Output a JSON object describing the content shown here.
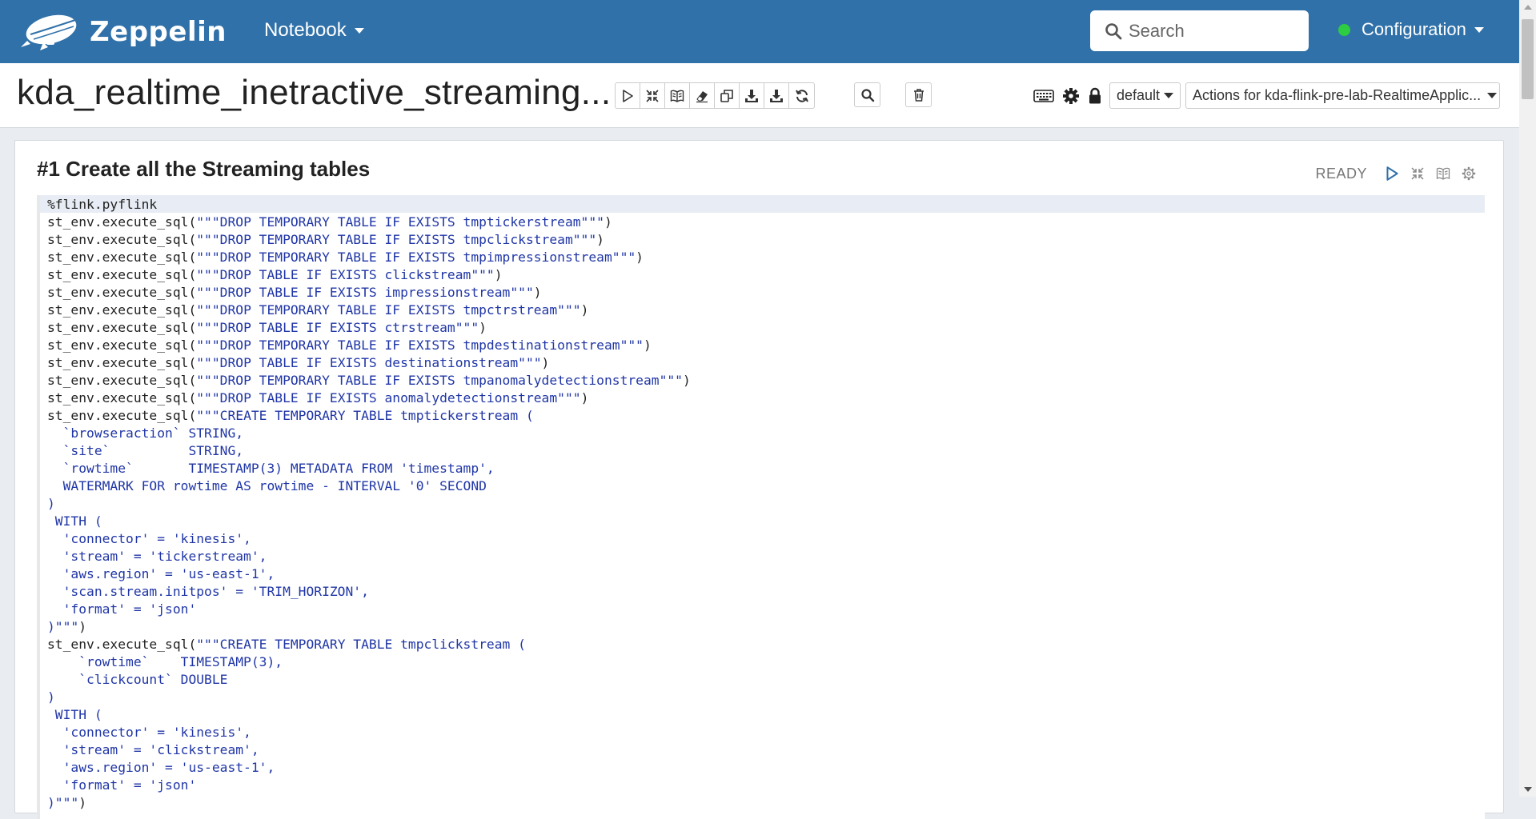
{
  "navbar": {
    "brand": "Zeppelin",
    "notebook_menu": "Notebook",
    "search_placeholder": "Search",
    "configuration": "Configuration"
  },
  "colors": {
    "navbar": "#3071a9",
    "status_connected": "#2ecc40",
    "code_string": "#2036a6"
  },
  "notebook": {
    "title": "kda_realtime_inetractive_streaming...",
    "toolbar_icons": [
      "run-all-icon",
      "hide-code-icon",
      "hide-output-icon",
      "clear-output-icon",
      "clone-icon",
      "export-icon",
      "export-ipynb-icon",
      "reload-icon",
      "search-code-icon",
      "trash-icon"
    ],
    "interpreter_select": "default",
    "actions_select": "Actions for kda-flink-pre-lab-RealtimeApplic..."
  },
  "paragraph": {
    "title": "#1 Create all the Streaming tables",
    "status": "READY",
    "code_lines": [
      [
        {
          "t": "%flink.pyflink",
          "s": false
        }
      ],
      [
        {
          "t": "st_env.execute_sql(",
          "s": false
        },
        {
          "t": "\"\"\"DROP TEMPORARY TABLE IF EXISTS tmptickerstream\"\"\"",
          "s": true
        },
        {
          "t": ")",
          "s": false
        }
      ],
      [
        {
          "t": "st_env.execute_sql(",
          "s": false
        },
        {
          "t": "\"\"\"DROP TEMPORARY TABLE IF EXISTS tmpclickstream\"\"\"",
          "s": true
        },
        {
          "t": ")",
          "s": false
        }
      ],
      [
        {
          "t": "st_env.execute_sql(",
          "s": false
        },
        {
          "t": "\"\"\"DROP TEMPORARY TABLE IF EXISTS tmpimpressionstream\"\"\"",
          "s": true
        },
        {
          "t": ")",
          "s": false
        }
      ],
      [
        {
          "t": "st_env.execute_sql(",
          "s": false
        },
        {
          "t": "\"\"\"DROP TABLE IF EXISTS clickstream\"\"\"",
          "s": true
        },
        {
          "t": ")",
          "s": false
        }
      ],
      [
        {
          "t": "st_env.execute_sql(",
          "s": false
        },
        {
          "t": "\"\"\"DROP TABLE IF EXISTS impressionstream\"\"\"",
          "s": true
        },
        {
          "t": ")",
          "s": false
        }
      ],
      [
        {
          "t": "st_env.execute_sql(",
          "s": false
        },
        {
          "t": "\"\"\"DROP TEMPORARY TABLE IF EXISTS tmpctrstream\"\"\"",
          "s": true
        },
        {
          "t": ")",
          "s": false
        }
      ],
      [
        {
          "t": "st_env.execute_sql(",
          "s": false
        },
        {
          "t": "\"\"\"DROP TABLE IF EXISTS ctrstream\"\"\"",
          "s": true
        },
        {
          "t": ")",
          "s": false
        }
      ],
      [
        {
          "t": "st_env.execute_sql(",
          "s": false
        },
        {
          "t": "\"\"\"DROP TEMPORARY TABLE IF EXISTS tmpdestinationstream\"\"\"",
          "s": true
        },
        {
          "t": ")",
          "s": false
        }
      ],
      [
        {
          "t": "st_env.execute_sql(",
          "s": false
        },
        {
          "t": "\"\"\"DROP TABLE IF EXISTS destinationstream\"\"\"",
          "s": true
        },
        {
          "t": ")",
          "s": false
        }
      ],
      [
        {
          "t": "st_env.execute_sql(",
          "s": false
        },
        {
          "t": "\"\"\"DROP TEMPORARY TABLE IF EXISTS tmpanomalydetectionstream\"\"\"",
          "s": true
        },
        {
          "t": ")",
          "s": false
        }
      ],
      [
        {
          "t": "st_env.execute_sql(",
          "s": false
        },
        {
          "t": "\"\"\"DROP TABLE IF EXISTS anomalydetectionstream\"\"\"",
          "s": true
        },
        {
          "t": ")",
          "s": false
        }
      ],
      [
        {
          "t": "st_env.execute_sql(",
          "s": false
        },
        {
          "t": "\"\"\"CREATE TEMPORARY TABLE tmptickerstream (",
          "s": true
        }
      ],
      [
        {
          "t": "  `browseraction` STRING,",
          "s": true
        }
      ],
      [
        {
          "t": "  `site`          STRING,",
          "s": true
        }
      ],
      [
        {
          "t": "  `rowtime`       TIMESTAMP(3) METADATA FROM 'timestamp',",
          "s": true
        }
      ],
      [
        {
          "t": "  WATERMARK FOR rowtime AS rowtime - INTERVAL '0' SECOND",
          "s": true
        }
      ],
      [
        {
          "t": ")",
          "s": true
        }
      ],
      [
        {
          "t": " WITH (",
          "s": true
        }
      ],
      [
        {
          "t": "  'connector' = 'kinesis',",
          "s": true
        }
      ],
      [
        {
          "t": "  'stream' = 'tickerstream',",
          "s": true
        }
      ],
      [
        {
          "t": "  'aws.region' = 'us-east-1',",
          "s": true
        }
      ],
      [
        {
          "t": "  'scan.stream.initpos' = 'TRIM_HORIZON',",
          "s": true
        }
      ],
      [
        {
          "t": "  'format' = 'json'",
          "s": true
        }
      ],
      [
        {
          "t": ")\"\"\"",
          "s": true
        },
        {
          "t": ")",
          "s": false
        }
      ],
      [
        {
          "t": "st_env.execute_sql(",
          "s": false
        },
        {
          "t": "\"\"\"CREATE TEMPORARY TABLE tmpclickstream (",
          "s": true
        }
      ],
      [
        {
          "t": "    `rowtime`    TIMESTAMP(3),",
          "s": true
        }
      ],
      [
        {
          "t": "    `clickcount` DOUBLE",
          "s": true
        }
      ],
      [
        {
          "t": ")",
          "s": true
        }
      ],
      [
        {
          "t": " WITH (",
          "s": true
        }
      ],
      [
        {
          "t": "  'connector' = 'kinesis',",
          "s": true
        }
      ],
      [
        {
          "t": "  'stream' = 'clickstream',",
          "s": true
        }
      ],
      [
        {
          "t": "  'aws.region' = 'us-east-1',",
          "s": true
        }
      ],
      [
        {
          "t": "  'format' = 'json'",
          "s": true
        }
      ],
      [
        {
          "t": ")\"\"\"",
          "s": true
        },
        {
          "t": ")",
          "s": false
        }
      ]
    ]
  }
}
